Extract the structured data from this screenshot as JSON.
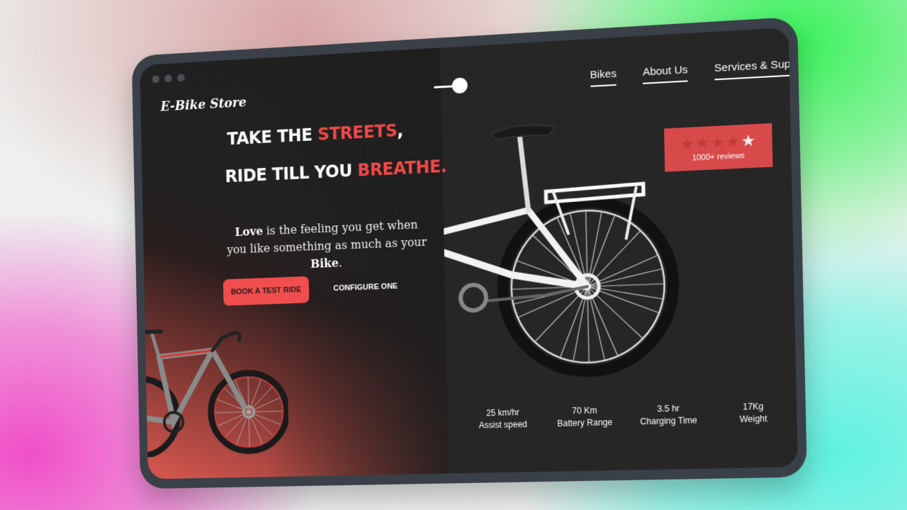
{
  "brand": {
    "name": "E-Bike Store"
  },
  "nav": {
    "items": [
      {
        "label": "Bikes"
      },
      {
        "label": "About Us"
      },
      {
        "label": "Services & Supp"
      }
    ]
  },
  "hero": {
    "line1_prefix": "TAKE THE ",
    "line1_accent": "STREETS",
    "line1_suffix": ",",
    "line2_prefix": "RIDE TILL YOU ",
    "line2_accent": "BREATHE.",
    "tagline_bold1": "Love",
    "tagline_mid": " is the feeling you get when you like something as much as your ",
    "tagline_bold2": "Bike",
    "tagline_end": "."
  },
  "buttons": {
    "primary": "BOOK A TEST RIDE",
    "secondary": "CONFIGURE ONE"
  },
  "rating": {
    "stars": 4,
    "max": 5,
    "reviews": "1000+ reviews"
  },
  "specs": [
    {
      "value": "25 km/hr",
      "label": "Assist speed"
    },
    {
      "value": "70 Km",
      "label": "Battery Range"
    },
    {
      "value": "3.5 hr",
      "label": "Charging Time"
    },
    {
      "value": "17Kg",
      "label": "Weight"
    }
  ],
  "colors": {
    "accent": "#f04848",
    "background": "#252525",
    "rating_bg": "#d84a4a"
  },
  "icons": {
    "toggle": "theme-toggle-icon",
    "star": "star-icon"
  }
}
